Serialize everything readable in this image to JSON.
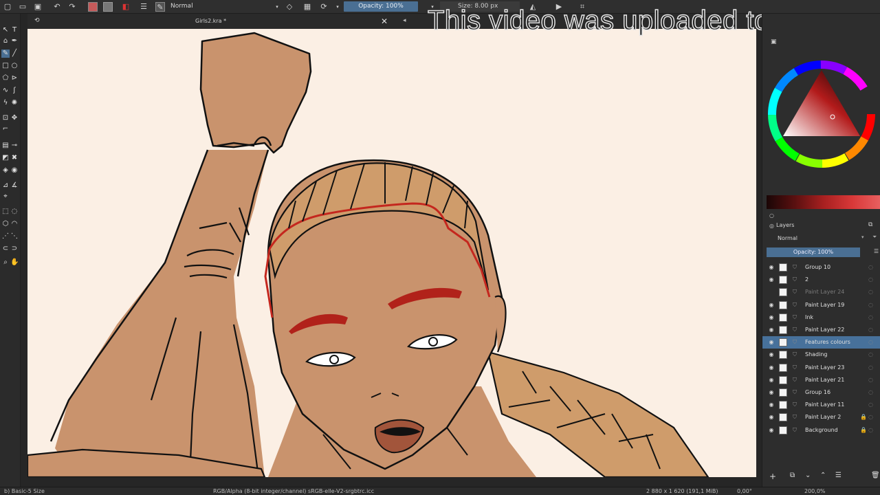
{
  "toolbar": {
    "blend_mode": "Normal",
    "opacity": "Opacity: 100%",
    "size": "Size: 8.00 px"
  },
  "document_tab": {
    "title": "Girls2.kra *"
  },
  "overlay": {
    "watermark": "This video was uploaded to w"
  },
  "layers_panel": {
    "title": "Layers",
    "blend_mode": "Normal",
    "opacity": "Opacity: 100%",
    "layers": [
      {
        "name": "Group 10",
        "visible": true,
        "selected": false
      },
      {
        "name": "2",
        "visible": true,
        "selected": false
      },
      {
        "name": "Paint Layer 24",
        "visible": false,
        "selected": false
      },
      {
        "name": "Paint Layer 19",
        "visible": true,
        "selected": false
      },
      {
        "name": "Ink",
        "visible": true,
        "selected": false
      },
      {
        "name": "Paint Layer 22",
        "visible": true,
        "selected": false
      },
      {
        "name": "Features colours",
        "visible": true,
        "selected": true
      },
      {
        "name": "Shading",
        "visible": true,
        "selected": false
      },
      {
        "name": "Paint Layer 23",
        "visible": true,
        "selected": false
      },
      {
        "name": "Paint Layer 21",
        "visible": true,
        "selected": false
      },
      {
        "name": "Group 16",
        "visible": true,
        "selected": false
      },
      {
        "name": "Paint Layer 11",
        "visible": true,
        "selected": false
      },
      {
        "name": "Paint Layer 2",
        "visible": true,
        "selected": false,
        "locked": true
      },
      {
        "name": "Background",
        "visible": true,
        "selected": false,
        "locked": true
      }
    ]
  },
  "status_bar": {
    "brush_preset": "b) Basic-5 Size",
    "color_space": "RGB/Alpha (8-bit integer/channel)  sRGB-elle-V2-srgbtrc.icc",
    "image_size": "2 880 x 1 620 (191,1 MiB)",
    "rotation": "0,00°",
    "zoom": "200,0%"
  },
  "colors": {
    "canvas_bg": "#fbefe4",
    "skin": "#c9936d",
    "hair": "#cf9c6b",
    "line_red": "#c4271e",
    "selection": "#47719b"
  }
}
